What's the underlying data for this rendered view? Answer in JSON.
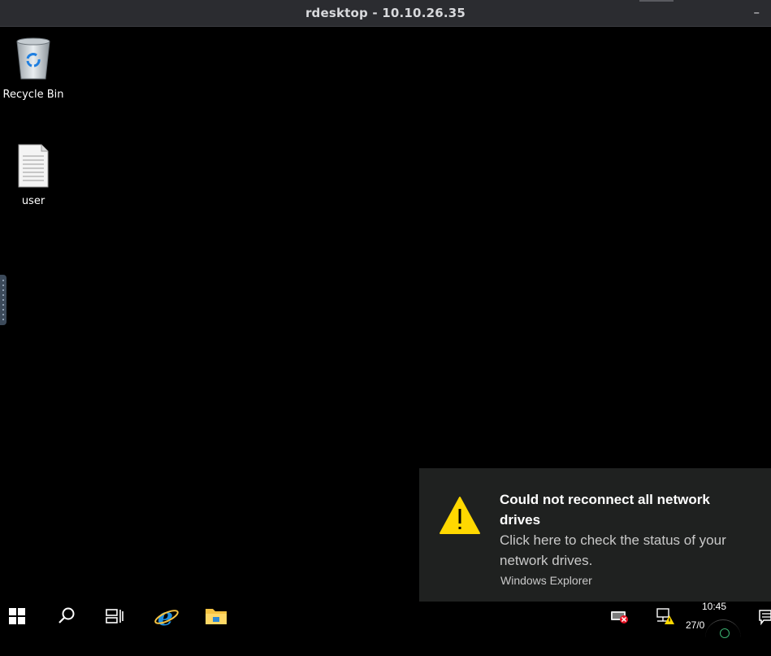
{
  "window": {
    "title": "rdesktop - 10.10.26.35",
    "minimize_glyph": "–"
  },
  "desktop": {
    "icons": [
      {
        "label": "Recycle Bin",
        "icon": "recycle-bin-icon"
      },
      {
        "label": "user",
        "icon": "text-file-icon"
      }
    ]
  },
  "notification": {
    "icon": "warning-icon",
    "title": "Could not reconnect all network drives",
    "body": "Click here to check the status of your network drives.",
    "source": "Windows Explorer"
  },
  "taskbar": {
    "items": [
      {
        "name": "start",
        "icon": "windows-logo-icon"
      },
      {
        "name": "search",
        "icon": "search-icon"
      },
      {
        "name": "task-view",
        "icon": "task-view-icon"
      },
      {
        "name": "internet-explorer",
        "icon": "internet-explorer-icon"
      },
      {
        "name": "file-explorer",
        "icon": "folder-icon"
      }
    ],
    "tray": {
      "time": "10:45",
      "date": "27/0"
    }
  },
  "colors": {
    "titlebar": "#2b2c30",
    "toast_bg": "#1f2120",
    "warning_yellow": "#ffd800",
    "ie_blue": "#1e8fe0",
    "folder_yellow": "#f5c342"
  }
}
